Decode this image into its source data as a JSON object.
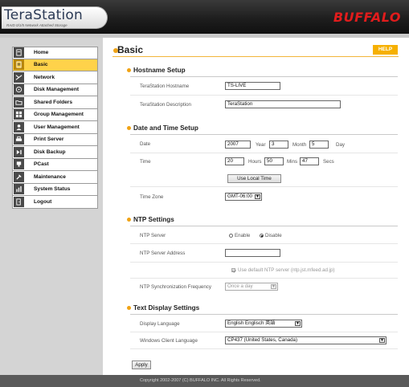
{
  "header": {
    "logo": "TeraStation",
    "tagline": "RAID 0/1/5 Network Attached Storage",
    "brand": "BUFFALO"
  },
  "sidebar": {
    "items": [
      {
        "label": "Home",
        "icon": "home-icon"
      },
      {
        "label": "Basic",
        "icon": "basic-settings-icon",
        "active": true
      },
      {
        "label": "Network",
        "icon": "network-icon"
      },
      {
        "label": "Disk Management",
        "icon": "disk-icon"
      },
      {
        "label": "Shared Folders",
        "icon": "folder-icon"
      },
      {
        "label": "Group Management",
        "icon": "group-icon"
      },
      {
        "label": "User Management",
        "icon": "user-icon"
      },
      {
        "label": "Print Server",
        "icon": "printer-icon"
      },
      {
        "label": "Disk Backup",
        "icon": "backup-icon"
      },
      {
        "label": "PCast",
        "icon": "pcast-icon"
      },
      {
        "label": "Maintenance",
        "icon": "tools-icon"
      },
      {
        "label": "System Status",
        "icon": "status-icon"
      },
      {
        "label": "Logout",
        "icon": "logout-icon"
      }
    ]
  },
  "main": {
    "title": "Basic",
    "help_label": "HELP",
    "hostname": {
      "title": "Hostname Setup",
      "hostname_label": "TeraStation Hostname",
      "hostname_value": "TS-LIVE",
      "description_label": "TeraStation Description",
      "description_value": "TeraStation"
    },
    "datetime": {
      "title": "Date and Time Setup",
      "date_label": "Date",
      "year_value": "2007",
      "year_unit": "Year",
      "month_value": "3",
      "month_unit": "Month",
      "day_value": "5",
      "day_unit": "Day",
      "time_label": "Time",
      "hours_value": "20",
      "hours_unit": "Hours",
      "mins_value": "50",
      "mins_unit": "Mins",
      "secs_value": "47",
      "secs_unit": "Secs",
      "use_local_time": "Use Local Time",
      "timezone_label": "Time Zone",
      "timezone_value": "GMT-06:00"
    },
    "ntp": {
      "title": "NTP Settings",
      "server_label": "NTP Server",
      "enable_label": "Enable",
      "disable_label": "Disable",
      "selected": "Disable",
      "address_label": "NTP Server Address",
      "address_value": "",
      "default_server_label": "Use default NTP server (ntp.jst.mfeed.ad.jp)",
      "sync_label": "NTP Synchronization Frequency",
      "sync_value": "Once a day"
    },
    "display": {
      "title": "Text Display Settings",
      "language_label": "Display Language",
      "language_value": "English Englisch 英語",
      "client_label": "Windows Client Language",
      "client_value": "CP437 (United States, Canada)"
    },
    "apply_label": "Apply"
  },
  "footer": {
    "copyright": "Copyright 2002-2007 (C) BUFFALO INC. All Rights Reserved."
  },
  "colors": {
    "accent": "#f6b000",
    "active_nav": "#ffd24a",
    "brand": "#e11c1c",
    "header": "#1e1e1e",
    "sidebar": "#d4d4d4"
  }
}
